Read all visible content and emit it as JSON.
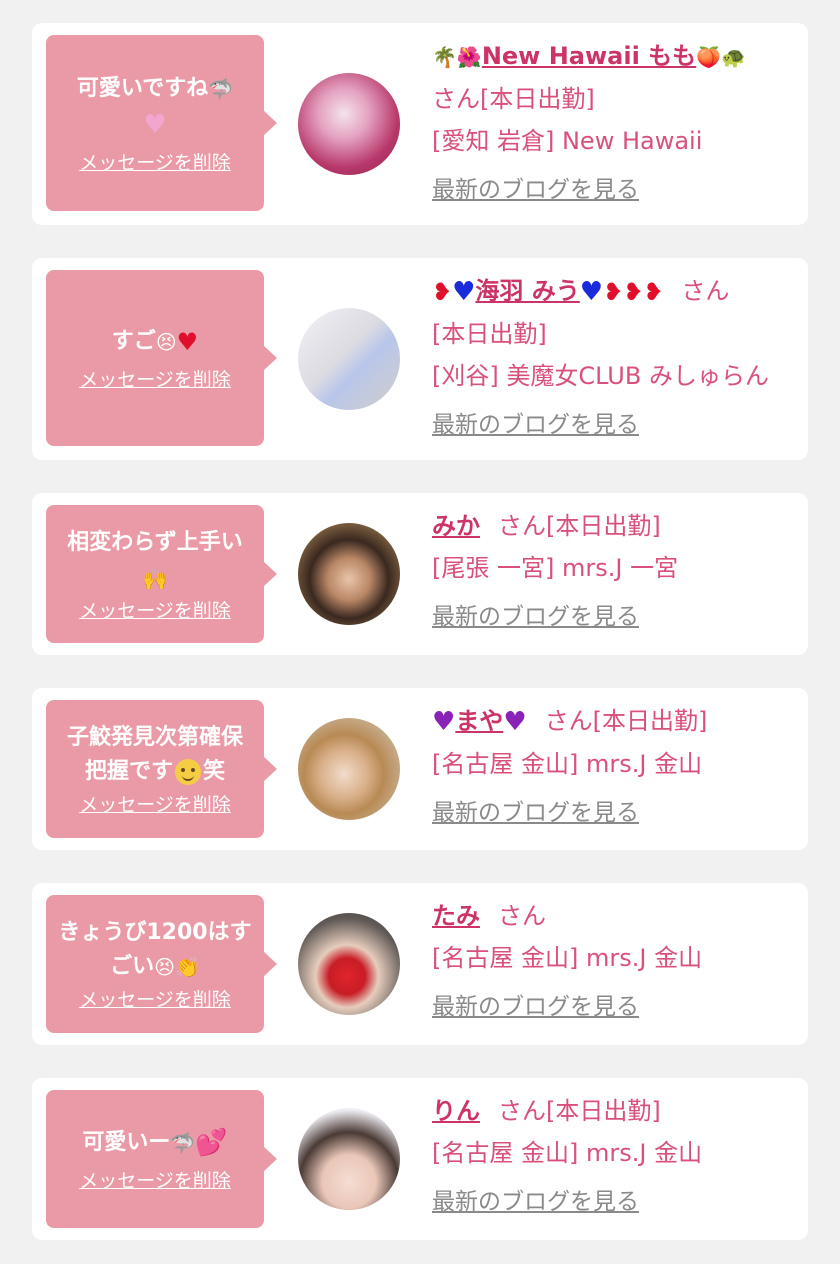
{
  "delete_label": "メッセージを削除",
  "blog_label": "最新のブログを見る",
  "san": "さん",
  "items": [
    {
      "message": "可愛いですね",
      "name": "New Hawaii もも",
      "status": "さん[本日出勤]",
      "shop": "[愛知 岩倉] New Hawaii",
      "avatar_colors": [
        "#e6b7c9",
        "#b13a67",
        "#f0d8e6"
      ]
    },
    {
      "message": "すご",
      "name": "海羽 みう",
      "status": "[本日出勤]",
      "shop": "[刈谷] 美魔女CLUB みしゅらん",
      "avatar_colors": [
        "#eef0f6",
        "#b7c6ea",
        "#d8d4cf"
      ]
    },
    {
      "message": "相変わらず上手い",
      "name": "みか",
      "status": "[本日出勤]",
      "shop": "[尾張 一宮] mrs.J 一宮",
      "avatar_colors": [
        "#c8a26c",
        "#3d2a22",
        "#e7c2a8"
      ]
    },
    {
      "message": "子鮫発見次第確保 把握です 笑",
      "name": "まや",
      "status": "[本日出勤]",
      "shop": "[名古屋 金山] mrs.J 金山",
      "avatar_colors": [
        "#d9d3cb",
        "#b88a54",
        "#f0dcc8"
      ]
    },
    {
      "message": "きょうび1200はすごい",
      "name": "たみ",
      "status": "",
      "shop": "[名古屋 金山] mrs.J 金山",
      "avatar_colors": [
        "#5b5552",
        "#d8262e",
        "#e8d3c4"
      ]
    },
    {
      "message": "可愛いー",
      "name": "りん",
      "status": "[本日出勤]",
      "shop": "[名古屋 金山] mrs.J 金山",
      "avatar_colors": [
        "#f0eef0",
        "#4a3a35",
        "#f0d9cf"
      ]
    }
  ]
}
